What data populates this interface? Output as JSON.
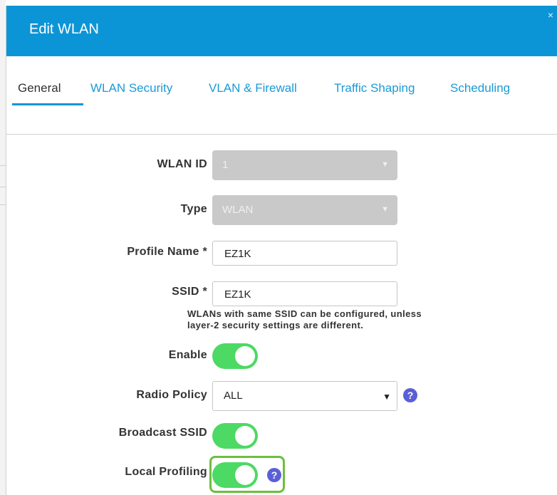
{
  "dialog": {
    "title": "Edit WLAN",
    "close_glyph": "×"
  },
  "tabs": [
    {
      "label": "General",
      "active": true
    },
    {
      "label": "WLAN Security",
      "active": false
    },
    {
      "label": "VLAN & Firewall",
      "active": false
    },
    {
      "label": "Traffic Shaping",
      "active": false
    },
    {
      "label": "Scheduling",
      "active": false
    }
  ],
  "form": {
    "wlan_id": {
      "label": "WLAN ID",
      "value": "1",
      "disabled": true
    },
    "type": {
      "label": "Type",
      "value": "WLAN",
      "disabled": true
    },
    "profile_name": {
      "label": "Profile Name *",
      "value": "EZ1K"
    },
    "ssid": {
      "label": "SSID *",
      "value": "EZ1K",
      "hint_line1": "WLANs with same SSID can be configured, unless",
      "hint_line2": "layer-2 security settings are different."
    },
    "enable": {
      "label": "Enable",
      "on": true
    },
    "radio_policy": {
      "label": "Radio Policy",
      "value": "ALL",
      "help_glyph": "?"
    },
    "broadcast_ssid": {
      "label": "Broadcast SSID",
      "on": true
    },
    "local_profiling": {
      "label": "Local Profiling",
      "on": true,
      "help_glyph": "?",
      "highlighted": true
    }
  },
  "colors": {
    "header": "#0c95d6",
    "tab_link": "#1a9ad6",
    "toggle_on": "#4cd964",
    "help_icon": "#5b5fd6",
    "highlight": "#6cbf3c"
  },
  "icons": {
    "close": "close-icon",
    "caret": "caret-down-icon",
    "help": "question-circle-icon"
  }
}
